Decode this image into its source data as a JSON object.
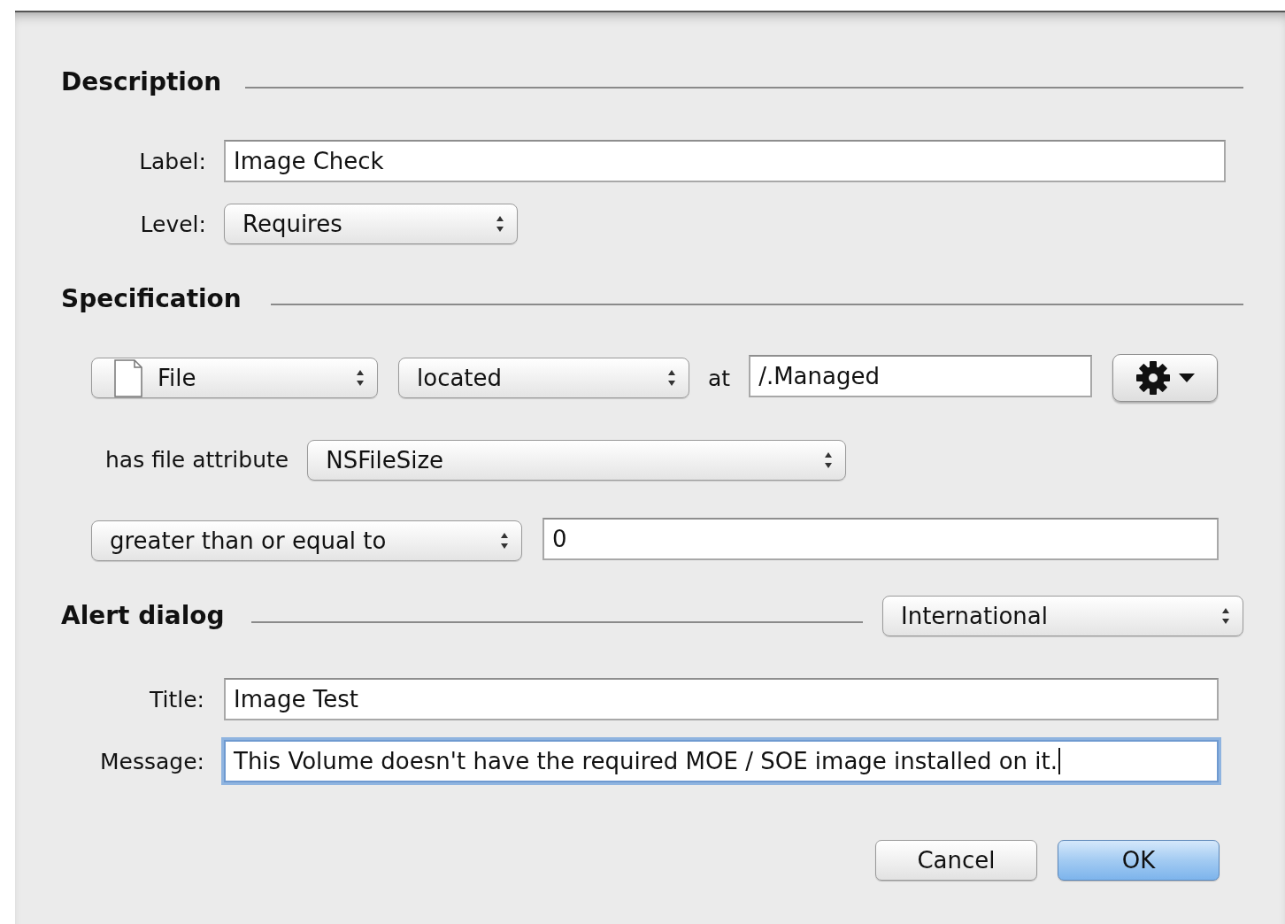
{
  "description": {
    "heading": "Description",
    "fields": [
      {
        "kind": "text",
        "caption": "Label:",
        "value": "Image Check",
        "focused": false
      },
      {
        "kind": "popup",
        "caption": "Level:",
        "value": "Requires"
      }
    ]
  },
  "specification": {
    "heading": "Specification",
    "rows": [
      [
        {
          "kind": "icon_popup",
          "value": "File"
        },
        {
          "kind": "popup",
          "value": "located"
        },
        {
          "kind": "label",
          "text": "at"
        },
        {
          "kind": "field",
          "value": "/.Managed",
          "focused": false
        },
        {
          "kind": "action_menu"
        }
      ],
      [
        {
          "kind": "label",
          "text": "has file attribute"
        },
        {
          "kind": "popup",
          "value": "NSFileSize"
        }
      ],
      [
        {
          "kind": "popup",
          "value": "greater than or equal to"
        },
        {
          "kind": "field",
          "value": "0",
          "focused": false
        }
      ]
    ]
  },
  "alert_dialog": {
    "heading": "Alert dialog",
    "language": "International",
    "fields": [
      {
        "kind": "text",
        "caption": "Title:",
        "value": "Image Test",
        "focused": false
      },
      {
        "kind": "text",
        "caption": "Message:",
        "value": "This Volume doesn't have the required MOE / SOE image installed on it.",
        "focused": true
      }
    ]
  },
  "buttons": [
    {
      "label": "Cancel",
      "default": false
    },
    {
      "label": "OK",
      "default": true
    }
  ]
}
